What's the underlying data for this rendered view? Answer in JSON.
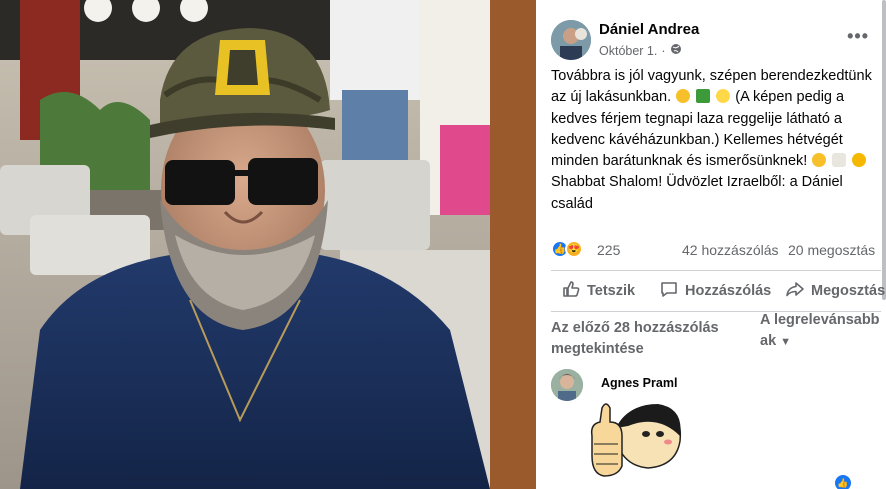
{
  "post": {
    "author": "Dániel Andrea",
    "date": "Október 1.",
    "privacy_icon": "globe-icon",
    "more_icon": "more-options-icon",
    "text_lines": [
      "Továbbra is jól vagyunk, szépen berendezkedtünk",
      "az új lakásunkban.",
      "(A képen pedig a",
      "kedves férjem tegnapi laza reggelije látható a",
      "kedvenc kávéházunkban.) Kellemes hétvégét",
      "minden barátunknak és ismerősünknek!",
      "Shabbat Shalom! Üdvözlet Izraelből: a Dániel",
      "család"
    ]
  },
  "stats": {
    "reaction_count": "225",
    "comments": "42 hozzászólás",
    "shares": "20 megosztás"
  },
  "actions": {
    "like": "Tetszik",
    "comment": "Hozzászólás",
    "share": "Megosztás"
  },
  "comments_section": {
    "previous": "Az előző 28 hozzászólás megtekintése",
    "sort": "A legrelevánsabbak",
    "first_comment_author": "Agnes Praml"
  },
  "colors": {
    "accent": "#1877f2",
    "secondary_text": "#65676b",
    "love": "#f33e58"
  }
}
